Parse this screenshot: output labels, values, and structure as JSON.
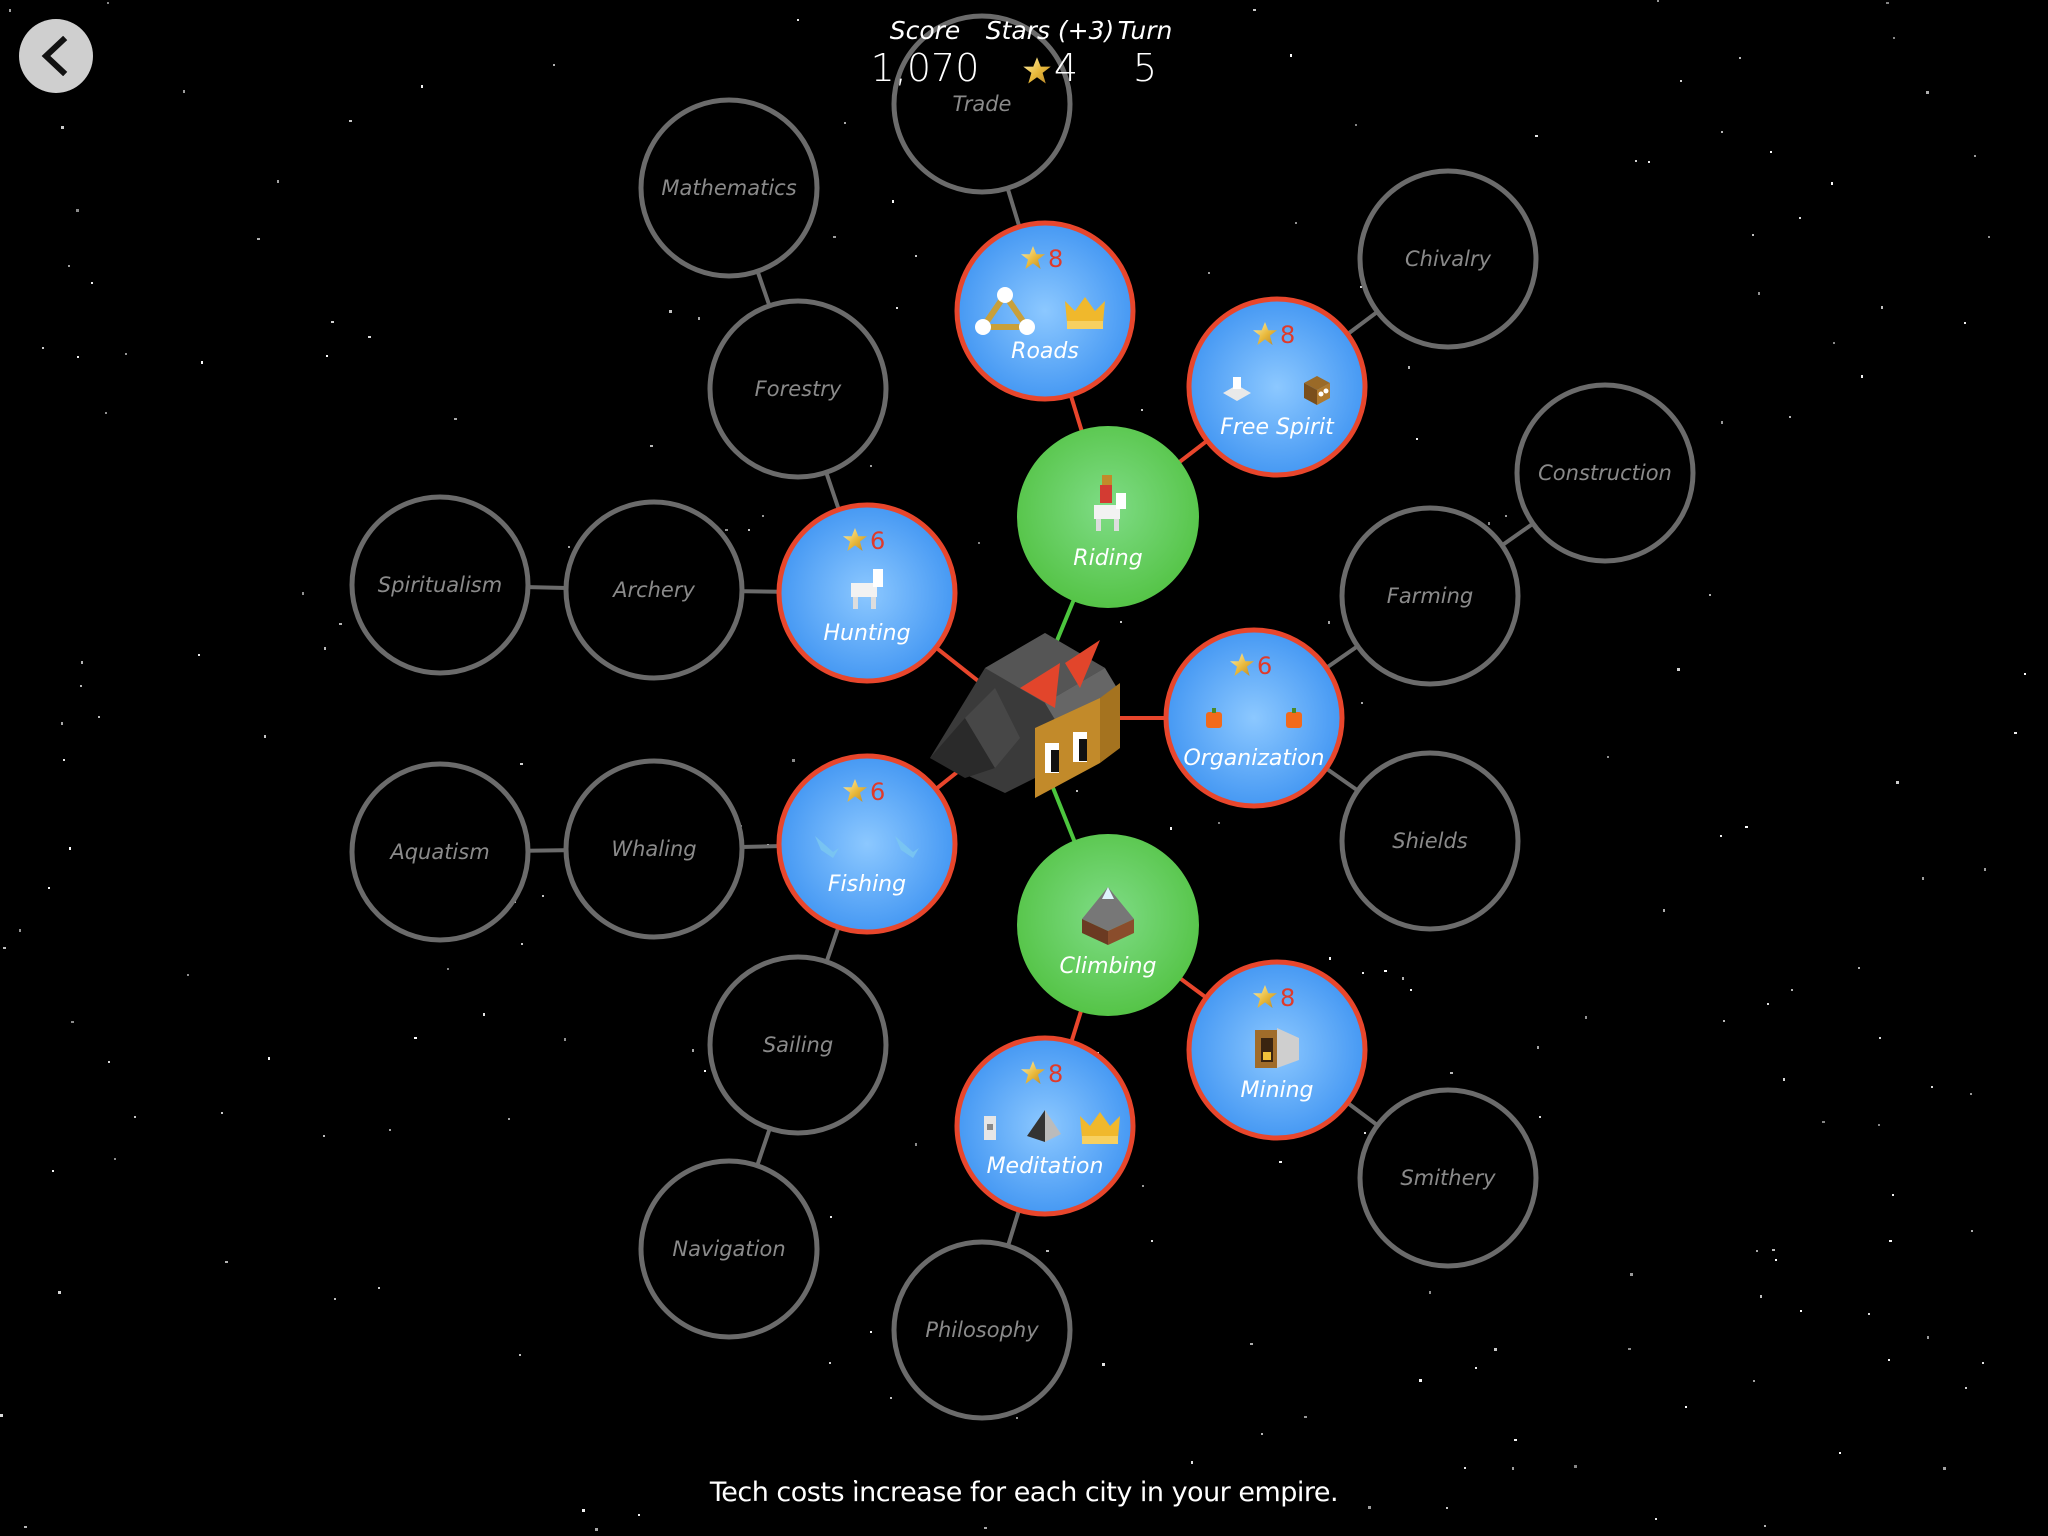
{
  "header": {
    "back_icon": "chevron-left-icon",
    "score_label": "Score",
    "score_value": "1,070",
    "stars_label": "Stars (+3)",
    "stars_value": "4",
    "turn_label": "Turn",
    "turn_value": "5"
  },
  "tribe": {
    "icon": "tribe-head-icon"
  },
  "colors": {
    "researched": "#5cc84e",
    "available": "#4a9cf5",
    "available_border": "#e8462c",
    "locked_border": "#6b6b6b",
    "locked_text": "#8a8a8a",
    "cost_text": "#e03a2a",
    "link_green": "#4cc63e",
    "link_red": "#e8462c",
    "link_gray": "#6b6b6b"
  },
  "techs": [
    {
      "id": "riding",
      "name": "Riding",
      "state": "researched",
      "icons": [
        "rider-icon"
      ]
    },
    {
      "id": "climbing",
      "name": "Climbing",
      "state": "researched",
      "icons": [
        "mountain-icon"
      ]
    },
    {
      "id": "roads",
      "name": "Roads",
      "state": "available",
      "cost": "8",
      "icons": [
        "road-network-icon",
        "crown-icon"
      ]
    },
    {
      "id": "free_spirit",
      "name": "Free Spirit",
      "state": "available",
      "cost": "8",
      "icons": [
        "temple-icon",
        "tribe-block-icon"
      ]
    },
    {
      "id": "hunting",
      "name": "Hunting",
      "state": "available",
      "cost": "6",
      "icons": [
        "animal-icon"
      ]
    },
    {
      "id": "organization",
      "name": "Organization",
      "state": "available",
      "cost": "6",
      "icons": [
        "fruit-icon",
        "fruit-icon"
      ]
    },
    {
      "id": "fishing",
      "name": "Fishing",
      "state": "available",
      "cost": "6",
      "icons": [
        "fish-icon",
        "fish-icon"
      ]
    },
    {
      "id": "mining",
      "name": "Mining",
      "state": "available",
      "cost": "8",
      "icons": [
        "mine-icon"
      ]
    },
    {
      "id": "meditation",
      "name": "Meditation",
      "state": "available",
      "cost": "8",
      "icons": [
        "mountain-temple-icon",
        "peak-icon",
        "crown-icon"
      ]
    },
    {
      "id": "trade",
      "name": "Trade",
      "state": "locked"
    },
    {
      "id": "mathematics",
      "name": "Mathematics",
      "state": "locked"
    },
    {
      "id": "forestry",
      "name": "Forestry",
      "state": "locked"
    },
    {
      "id": "chivalry",
      "name": "Chivalry",
      "state": "locked"
    },
    {
      "id": "construction",
      "name": "Construction",
      "state": "locked"
    },
    {
      "id": "farming",
      "name": "Farming",
      "state": "locked"
    },
    {
      "id": "shields",
      "name": "Shields",
      "state": "locked"
    },
    {
      "id": "spiritualism",
      "name": "Spiritualism",
      "state": "locked"
    },
    {
      "id": "archery",
      "name": "Archery",
      "state": "locked"
    },
    {
      "id": "aquatism",
      "name": "Aquatism",
      "state": "locked"
    },
    {
      "id": "whaling",
      "name": "Whaling",
      "state": "locked"
    },
    {
      "id": "sailing",
      "name": "Sailing",
      "state": "locked"
    },
    {
      "id": "navigation",
      "name": "Navigation",
      "state": "locked"
    },
    {
      "id": "philosophy",
      "name": "Philosophy",
      "state": "locked"
    },
    {
      "id": "smithery",
      "name": "Smithery",
      "state": "locked"
    }
  ],
  "links": [
    [
      "tribe",
      "riding"
    ],
    [
      "tribe",
      "climbing"
    ],
    [
      "tribe",
      "hunting"
    ],
    [
      "tribe",
      "organization"
    ],
    [
      "tribe",
      "fishing"
    ],
    [
      "riding",
      "roads"
    ],
    [
      "riding",
      "free_spirit"
    ],
    [
      "climbing",
      "mining"
    ],
    [
      "climbing",
      "meditation"
    ],
    [
      "roads",
      "trade"
    ],
    [
      "free_spirit",
      "chivalry"
    ],
    [
      "hunting",
      "forestry"
    ],
    [
      "hunting",
      "archery"
    ],
    [
      "forestry",
      "mathematics"
    ],
    [
      "archery",
      "spiritualism"
    ],
    [
      "organization",
      "farming"
    ],
    [
      "organization",
      "shields"
    ],
    [
      "farming",
      "construction"
    ],
    [
      "fishing",
      "whaling"
    ],
    [
      "fishing",
      "sailing"
    ],
    [
      "whaling",
      "aquatism"
    ],
    [
      "sailing",
      "navigation"
    ],
    [
      "meditation",
      "philosophy"
    ],
    [
      "mining",
      "smithery"
    ]
  ],
  "footer": {
    "hint": "Tech costs increase for each city in your empire."
  }
}
